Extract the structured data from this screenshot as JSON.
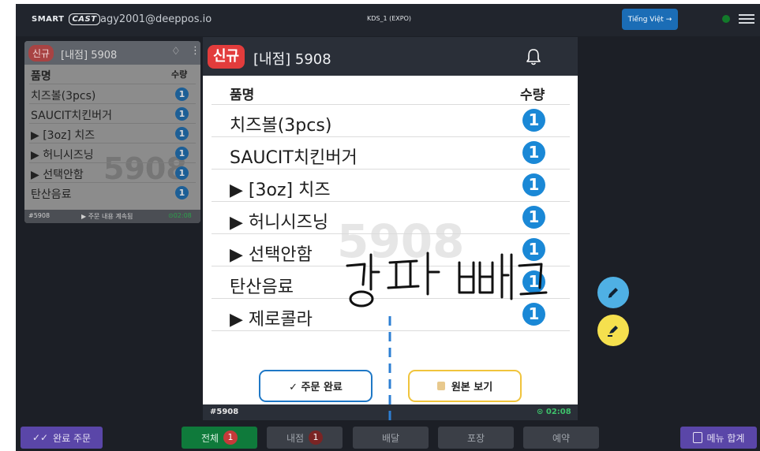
{
  "topbar": {
    "logo_a": "SMART",
    "logo_b": "CAST",
    "account": "agy2001@deeppos.io",
    "station": "KDS_1 (EXPO)",
    "lang_button": "Tiếng Việt →"
  },
  "bg_ticket": {
    "badge": "신규",
    "number": "[내점] 5908",
    "col_name": "품명",
    "col_qty": "수량",
    "watermark": "5908",
    "items": [
      {
        "name": "치즈볼(3pcs)",
        "qty": "1"
      },
      {
        "name": "SAUCIT치킨버거",
        "qty": "1"
      },
      {
        "name": "▶ [3oz] 치즈",
        "qty": "1"
      },
      {
        "name": "▶ 허니시즈닝",
        "qty": "1"
      },
      {
        "name": "▶ 선택안함",
        "qty": "1"
      },
      {
        "name": "탄산음료",
        "qty": "1"
      }
    ],
    "footer_id": "#5908",
    "footer_note": "▶ 주문 내용 계속됨",
    "footer_time": "⊙02:08"
  },
  "ticket": {
    "badge": "신규",
    "number": "[내점] 5908",
    "col_name": "품명",
    "col_qty": "수량",
    "watermark": "5908",
    "items": [
      {
        "name": "치즈볼(3pcs)",
        "qty": "1"
      },
      {
        "name": "SAUCIT치킨버거",
        "qty": "1"
      },
      {
        "name": "▶ [3oz] 치즈",
        "qty": "1"
      },
      {
        "name": "▶ 허니시즈닝",
        "qty": "1"
      },
      {
        "name": "▶ 선택안함",
        "qty": "1"
      },
      {
        "name": "탄산음료",
        "qty": "1"
      },
      {
        "name": "▶ 제로콜라",
        "qty": "1"
      }
    ],
    "done_button": "✓ 주문 완료",
    "original_button": "원본 보기",
    "footer_id": "#5908",
    "footer_time": "⊙ 02:08"
  },
  "handwriting": "강파 빼고",
  "bottombar": {
    "completed_orders": "완료 주문",
    "tabs": [
      {
        "label": "전체",
        "count": "1"
      },
      {
        "label": "내점",
        "count": "1"
      },
      {
        "label": "배달",
        "count": ""
      },
      {
        "label": "포장",
        "count": ""
      },
      {
        "label": "예약",
        "count": ""
      }
    ],
    "menu_total": "메뉴 합계"
  },
  "colors": {
    "new_badge": "#e23c3c",
    "qty_badge": "#1a88d6",
    "accent_purple": "#5a46a8",
    "active_tab": "#0f7a3b",
    "timer_green": "#3ec26b"
  }
}
